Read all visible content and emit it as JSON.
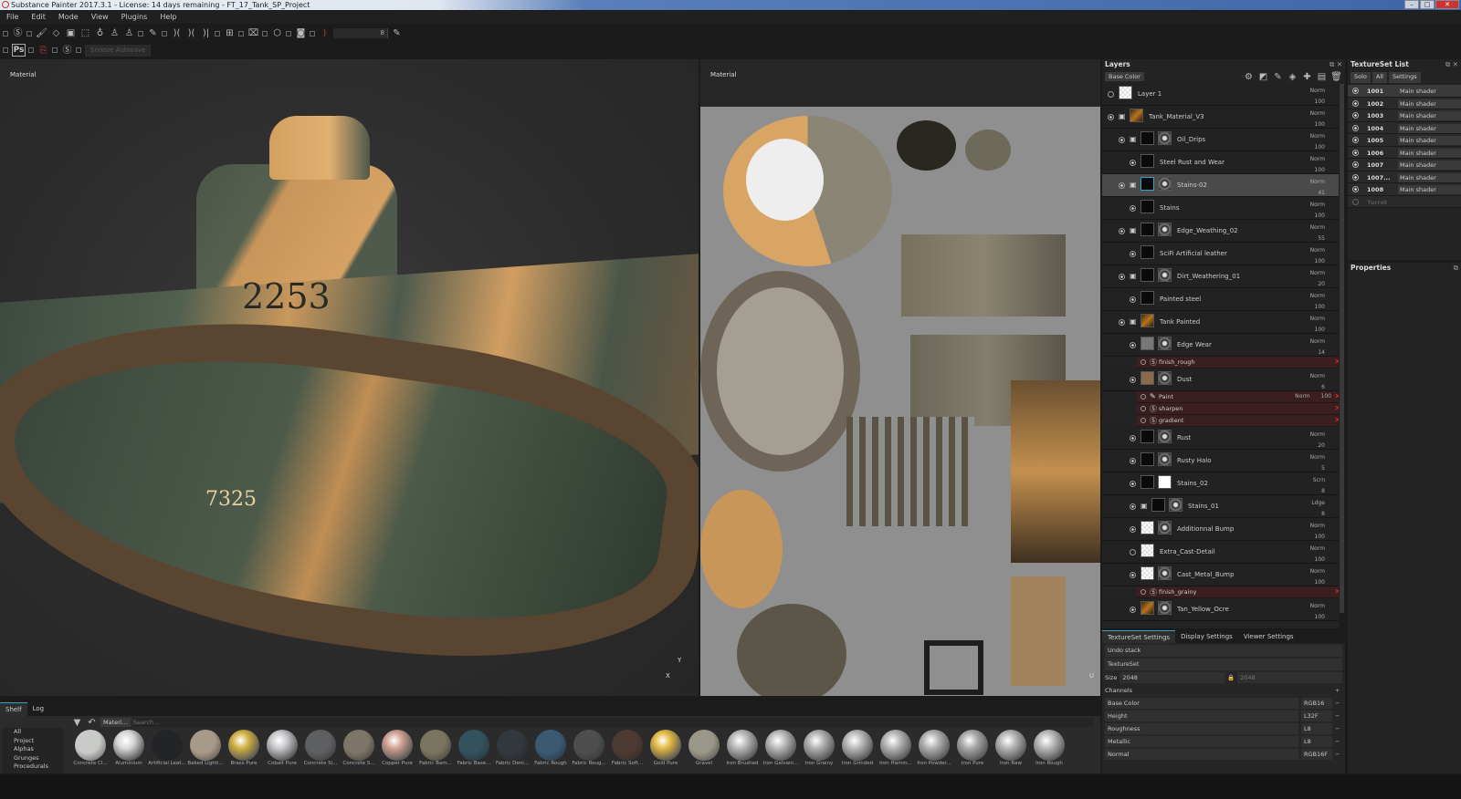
{
  "window": {
    "title": "Substance Painter 2017.3.1 - License: 14 days remaining - FT_17_Tank_SP_Project",
    "min": "–",
    "max": "□",
    "close": "✕"
  },
  "menu": [
    "File",
    "Edit",
    "Mode",
    "View",
    "Plugins",
    "Help"
  ],
  "toolbar": {
    "brush_size": "8",
    "snooze": "Snooze Autosave",
    "ps": "Ps"
  },
  "viewports": {
    "left_label": "Material",
    "right_label": "Material",
    "tank_number": "2253",
    "tank_number2": "7325",
    "axis_y": "Y",
    "axis_x": "X",
    "axis_u": "U"
  },
  "shelf": {
    "tabs": [
      "Shelf",
      "Log"
    ],
    "categories": [
      "All",
      "Project",
      "Alphas",
      "Grunges",
      "Procedurals"
    ],
    "filter_chip": "Materi...",
    "search_placeholder": "Search...",
    "materials": [
      {
        "name": "Concrete Cl...",
        "color": "#c9cbc8"
      },
      {
        "name": "Aluminium",
        "color": "#d8d8d8",
        "metal": true
      },
      {
        "name": "Artificial Leat...",
        "color": "#222428"
      },
      {
        "name": "Baked Lighti...",
        "color": "#a89a88"
      },
      {
        "name": "Brass Pure",
        "color": "#d0b040",
        "metal": true
      },
      {
        "name": "Cobalt Pure",
        "color": "#c8c8cc",
        "metal": true
      },
      {
        "name": "Concrete Si...",
        "color": "#5e5f61"
      },
      {
        "name": "Concrete S...",
        "color": "#7d7567"
      },
      {
        "name": "Copper Pure",
        "color": "#d0a090",
        "metal": true
      },
      {
        "name": "Fabric Bam...",
        "color": "#7a7560"
      },
      {
        "name": "Fabric Base...",
        "color": "#34515e"
      },
      {
        "name": "Fabric Deni...",
        "color": "#33383f"
      },
      {
        "name": "Fabric Rough",
        "color": "#3b5a72"
      },
      {
        "name": "Fabric Roug...",
        "color": "#4e4e4e"
      },
      {
        "name": "Fabric Soft...",
        "color": "#4d3a32"
      },
      {
        "name": "Gold Pure",
        "color": "#e0b840",
        "metal": true
      },
      {
        "name": "Gravel",
        "color": "#9a9788"
      },
      {
        "name": "Iron Brushed",
        "color": "#b8b8b8",
        "metal": true
      },
      {
        "name": "Iron Galvani...",
        "color": "#b8b8b8",
        "metal": true
      },
      {
        "name": "Iron Grainy",
        "color": "#b0b0b0",
        "metal": true
      },
      {
        "name": "Iron Grinded",
        "color": "#b8b8b8",
        "metal": true
      },
      {
        "name": "Iron Hamm...",
        "color": "#b4b4b4",
        "metal": true
      },
      {
        "name": "Iron Powder...",
        "color": "#b0b0b0",
        "metal": true
      },
      {
        "name": "Iron Pure",
        "color": "#a8a8a8",
        "metal": true
      },
      {
        "name": "Iron Raw",
        "color": "#b4b4b4",
        "metal": true
      },
      {
        "name": "Iron Rough",
        "color": "#b8b8b8",
        "metal": true
      }
    ]
  },
  "layers": {
    "title": "Layers",
    "channel": "Base Color",
    "rows": [
      {
        "kind": "layer",
        "name": "Layer 1",
        "blend": "Norm",
        "opacity": "100",
        "indent": 0,
        "eye": false,
        "thumb": "checker"
      },
      {
        "kind": "layer",
        "name": "Tank_Material_V3",
        "blend": "Norm",
        "opacity": "100",
        "indent": 0,
        "folder": true,
        "thumb": "orange"
      },
      {
        "kind": "layer",
        "name": "Oil_Drips",
        "blend": "Norm",
        "opacity": "100",
        "indent": 1,
        "folder": true,
        "mask": true
      },
      {
        "kind": "layer",
        "name": "Steel Rust and Wear",
        "blend": "Norm",
        "opacity": "100",
        "indent": 2
      },
      {
        "kind": "layer",
        "name": "Stains-02",
        "blend": "Norm",
        "opacity": "41",
        "indent": 1,
        "folder": true,
        "mask": true,
        "selected": true
      },
      {
        "kind": "layer",
        "name": "Stains",
        "blend": "Norm",
        "opacity": "100",
        "indent": 2
      },
      {
        "kind": "layer",
        "name": "Edge_Weathing_02",
        "blend": "Norm",
        "opacity": "55",
        "indent": 1,
        "folder": true,
        "mask": true
      },
      {
        "kind": "layer",
        "name": "SciFi Artificial leather",
        "blend": "Norm",
        "opacity": "100",
        "indent": 2
      },
      {
        "kind": "layer",
        "name": "Dirt_Weathering_01",
        "blend": "Norm",
        "opacity": "20",
        "indent": 1,
        "folder": true,
        "mask": true
      },
      {
        "kind": "layer",
        "name": "Painted steel",
        "blend": "Norm",
        "opacity": "100",
        "indent": 2
      },
      {
        "kind": "layer",
        "name": "Tank Painted",
        "blend": "Norm",
        "opacity": "100",
        "indent": 1,
        "folder": true,
        "thumb": "orange"
      },
      {
        "kind": "layer",
        "name": "Edge Wear",
        "blend": "Norm",
        "opacity": "14",
        "indent": 2,
        "mask": true,
        "thumb": "grey"
      },
      {
        "kind": "effect",
        "name": "finish_rough",
        "icon": "S"
      },
      {
        "kind": "layer",
        "name": "Dust",
        "blend": "Norm",
        "opacity": "6",
        "indent": 2,
        "mask": true,
        "thumb": "tan"
      },
      {
        "kind": "effect",
        "name": "Paint",
        "icon": "/",
        "blend": "Norm",
        "opacity": "100"
      },
      {
        "kind": "effect",
        "name": "sharpen",
        "icon": "S"
      },
      {
        "kind": "effect",
        "name": "gradient",
        "icon": "S"
      },
      {
        "kind": "layer",
        "name": "Rust",
        "blend": "Norm",
        "opacity": "20",
        "indent": 2,
        "mask": true
      },
      {
        "kind": "layer",
        "name": "Rusty Halo",
        "blend": "Norm",
        "opacity": "5",
        "indent": 2,
        "mask": true
      },
      {
        "kind": "layer",
        "name": "Stains_02",
        "blend": "Scrn",
        "opacity": "8",
        "indent": 2,
        "mask": true,
        "maskwhite": true
      },
      {
        "kind": "layer",
        "name": "Stains_01",
        "blend": "Ldge",
        "opacity": "8",
        "indent": 2,
        "folder": true,
        "mask": true
      },
      {
        "kind": "layer",
        "name": "Additionnal Bump",
        "blend": "Norm",
        "opacity": "100",
        "indent": 2,
        "mask": true,
        "thumb": "checker"
      },
      {
        "kind": "layer",
        "name": "Extra_Cast-Detail",
        "blend": "Norm",
        "opacity": "100",
        "indent": 2,
        "eye": false,
        "thumb": "checker"
      },
      {
        "kind": "layer",
        "name": "Cast_Metal_Bump",
        "blend": "Norm",
        "opacity": "100",
        "indent": 2,
        "mask": true,
        "thumb": "checker"
      },
      {
        "kind": "effect",
        "name": "finish_grainy",
        "icon": "S"
      },
      {
        "kind": "layer",
        "name": "Tan_Yellow_Ocre",
        "blend": "Norm",
        "opacity": "100",
        "indent": 2,
        "mask": true,
        "thumb": "orange"
      }
    ]
  },
  "textureset_list": {
    "title": "TextureSet List",
    "buttons": [
      "Solo",
      "All",
      "Settings"
    ],
    "sets": [
      {
        "id": "1001",
        "shader": "Main shader"
      },
      {
        "id": "1002",
        "shader": "Main shader"
      },
      {
        "id": "1003",
        "shader": "Main shader"
      },
      {
        "id": "1004",
        "shader": "Main shader"
      },
      {
        "id": "1005",
        "shader": "Main shader"
      },
      {
        "id": "1006",
        "shader": "Main shader"
      },
      {
        "id": "1007",
        "shader": "Main shader"
      },
      {
        "id": "1007...",
        "shader": "Main shader"
      },
      {
        "id": "1008",
        "shader": "Main shader"
      },
      {
        "id": "Turret",
        "shader": "",
        "disabled": true
      }
    ]
  },
  "properties": {
    "title": "Properties"
  },
  "textureset_settings": {
    "tabs": [
      "TextureSet Settings",
      "Display Settings",
      "Viewer Settings"
    ],
    "undo": "Undo stack",
    "section": "TextureSet",
    "size_label": "Size",
    "size": "2048",
    "size2": "2048",
    "channels_label": "Channels",
    "channels": [
      {
        "name": "Base Color",
        "format": "RGB16"
      },
      {
        "name": "Height",
        "format": "L32F"
      },
      {
        "name": "Roughness",
        "format": "L8"
      },
      {
        "name": "Metallic",
        "format": "L8"
      },
      {
        "name": "Normal",
        "format": "RGB16F"
      }
    ]
  },
  "colors": {
    "accent": "#3aa0c8",
    "effect_row": "#3a1e20",
    "close_red": "#d33333"
  }
}
